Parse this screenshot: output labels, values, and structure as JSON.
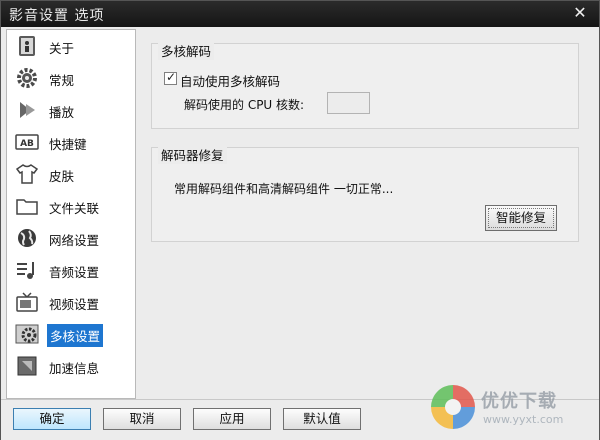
{
  "window": {
    "title": "影音设置 选项",
    "close_glyph": "✕"
  },
  "sidebar": {
    "selected_index": 10,
    "items": [
      {
        "label": "关于",
        "icon": "about-icon"
      },
      {
        "label": "常规",
        "icon": "gear-icon"
      },
      {
        "label": "播放",
        "icon": "play-icon"
      },
      {
        "label": "快捷键",
        "icon": "keyboard-icon"
      },
      {
        "label": "皮肤",
        "icon": "tshirt-icon"
      },
      {
        "label": "文件关联",
        "icon": "folder-icon"
      },
      {
        "label": "网络设置",
        "icon": "globe-icon"
      },
      {
        "label": "音频设置",
        "icon": "music-icon"
      },
      {
        "label": "视频设置",
        "icon": "tv-icon"
      },
      {
        "label": "多核设置",
        "icon": "multicore-gear-icon"
      },
      {
        "label": "加速信息",
        "icon": "accelerate-icon"
      }
    ]
  },
  "multicore": {
    "group_title": "多核解码",
    "auto_checkbox_label": "自动使用多核解码",
    "auto_checked": true,
    "cpu_label": "解码使用的 CPU 核数:",
    "cpu_value": ""
  },
  "repair": {
    "group_title": "解码器修复",
    "status": "常用解码组件和高清解码组件 一切正常...",
    "button_label": "智能修复"
  },
  "footer": {
    "ok": "确定",
    "cancel": "取消",
    "apply": "应用",
    "default": "默认值"
  },
  "watermark": {
    "text": "优优下载",
    "url": "www.yyxt.com"
  },
  "colors": {
    "titlebar": "#1f1f1f",
    "selection": "#1e76d0",
    "primary_button": "#bee6fd"
  }
}
